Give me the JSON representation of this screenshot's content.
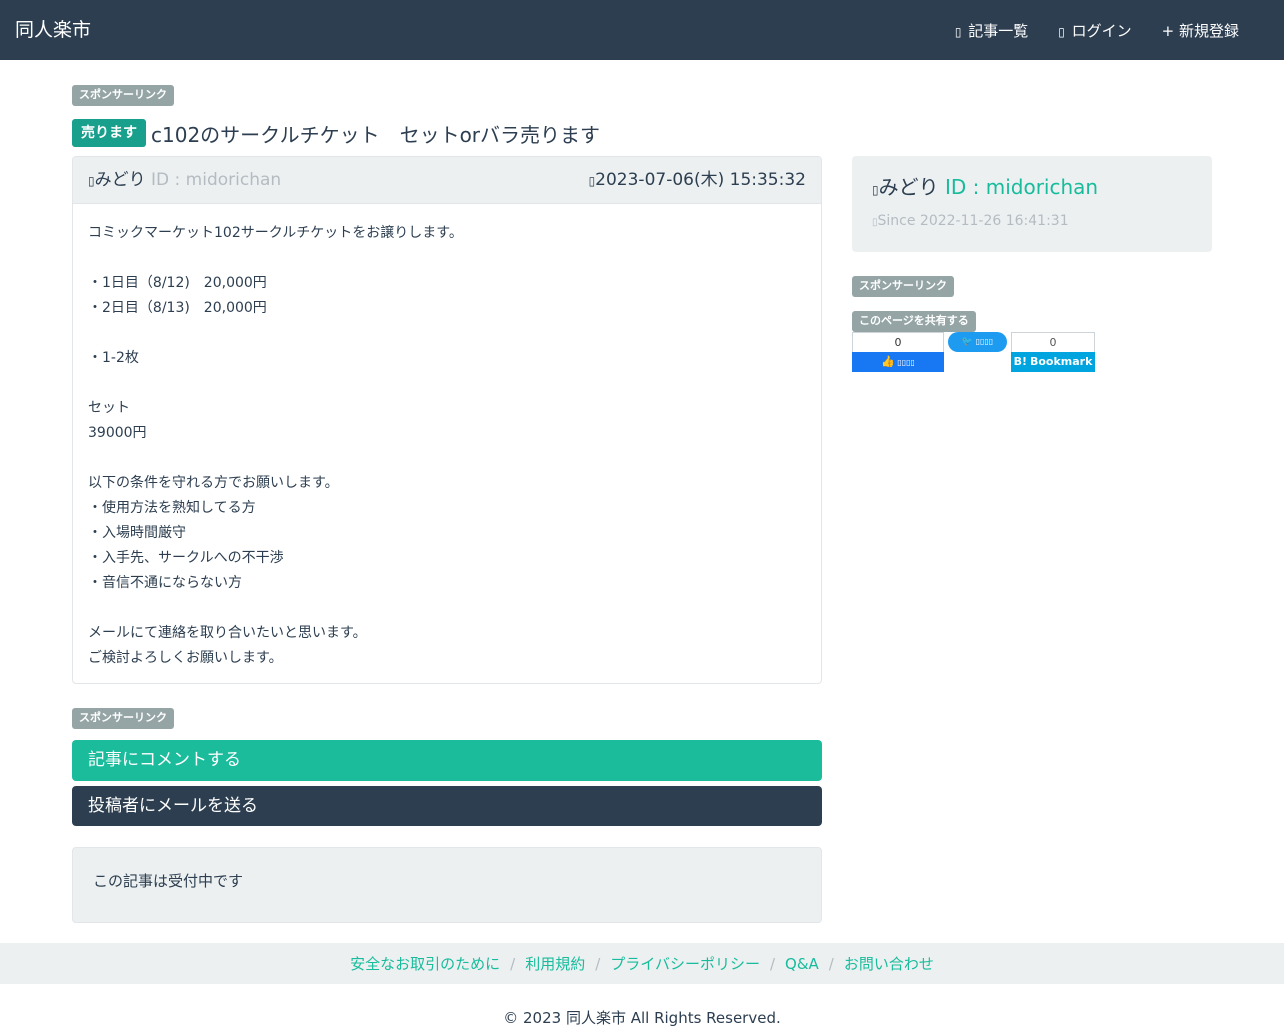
{
  "header": {
    "brand": "同人楽市",
    "nav": [
      {
        "icon": "list-icon",
        "label": "記事一覧"
      },
      {
        "icon": "login-icon",
        "label": "ログイン"
      },
      {
        "icon": "plus-icon",
        "label": "新規登録"
      }
    ]
  },
  "sponsor_label": "スポンサーリンク",
  "post": {
    "tag": "売ります",
    "title": "c102のサークルチケット　セットorバラ売ります",
    "author_name": "みどり",
    "author_id": "ID : midorichan",
    "date": "2023-07-06(木) 15:35:32",
    "body": [
      "コミックマーケット102サークルチケットをお譲りします。",
      "",
      "・1日目（8/12)　20,000円",
      "・2日目（8/13)　20,000円",
      "",
      "・1-2枚",
      "",
      "セット",
      "39000円",
      "",
      "以下の条件を守れる方でお願いします。",
      "・使用方法を熟知してる方",
      "・入場時間厳守",
      "・入手先、サークルへの不干渉",
      "・音信不通にならない方",
      "",
      "メールにて連絡を取り合いたいと思います。",
      "ご検討よろしくお願いします。"
    ]
  },
  "actions": {
    "comment": "記事にコメントする",
    "mail": "投稿者にメールを送る"
  },
  "status": "この記事は受付中です",
  "sidebar": {
    "name": "みどり",
    "id": "ID : midorichan",
    "since": "Since 2022-11-26 16:41:31",
    "share_label": "このページを共有する",
    "fb_count": "0",
    "hb_count": "0",
    "hb_label": "Bookmark"
  },
  "footer": {
    "links": [
      "安全なお取引のために",
      "利用規約",
      "プライバシーポリシー",
      "Q&A",
      "お問い合わせ"
    ],
    "copyright": "© 2023 同人楽市 All Rights Reserved."
  },
  "colors": {
    "navbar": "#2c3e50",
    "accent": "#1abc9c",
    "panel_bg": "#ecf0f1",
    "badge_gray": "#95a5a6"
  }
}
